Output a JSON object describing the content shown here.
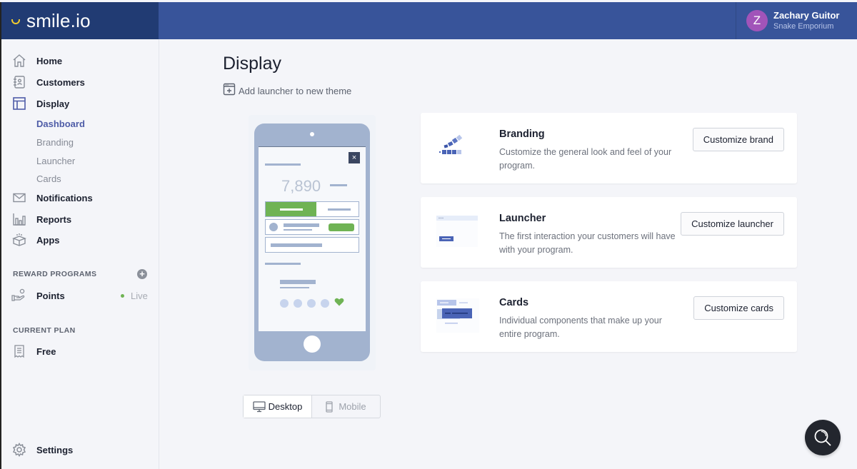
{
  "brand": {
    "name": "smile.io",
    "accent": "#f2cb2e"
  },
  "user": {
    "initial": "Z",
    "name": "Zachary Guitor",
    "store": "Snake Emporium",
    "avatar_color": "#a154b9"
  },
  "sidebar": {
    "items": [
      {
        "label": "Home",
        "icon": "home-icon"
      },
      {
        "label": "Customers",
        "icon": "contacts-book-icon"
      },
      {
        "label": "Display",
        "icon": "layout-icon",
        "active": true
      },
      {
        "label": "Notifications",
        "icon": "envelope-icon"
      },
      {
        "label": "Reports",
        "icon": "bar-chart-icon"
      },
      {
        "label": "Apps",
        "icon": "package-icon"
      }
    ],
    "display_subitems": [
      {
        "label": "Dashboard",
        "active": true
      },
      {
        "label": "Branding"
      },
      {
        "label": "Launcher"
      },
      {
        "label": "Cards"
      }
    ],
    "reward_programs": {
      "heading": "REWARD PROGRAMS",
      "add_label": "+",
      "items": [
        {
          "label": "Points",
          "status": "Live",
          "status_color": "#6fb354"
        }
      ]
    },
    "current_plan": {
      "heading": "CURRENT PLAN",
      "plan": "Free"
    },
    "settings_label": "Settings"
  },
  "main": {
    "title": "Display",
    "add_launcher_label": "Add launcher to new theme",
    "preview": {
      "points_value": "7,890",
      "close_glyph": "×",
      "view_options": [
        {
          "label": "Desktop",
          "selected": true
        },
        {
          "label": "Mobile",
          "selected": false
        }
      ]
    },
    "cards": [
      {
        "title": "Branding",
        "description": "Customize the general look and feel of your program.",
        "button": "Customize brand"
      },
      {
        "title": "Launcher",
        "description": "The first interaction your customers will have with your program.",
        "button": "Customize launcher"
      },
      {
        "title": "Cards",
        "description": "Individual components that make up your entire program.",
        "button": "Customize cards"
      }
    ]
  },
  "help_button": {
    "icon": "search-icon"
  }
}
